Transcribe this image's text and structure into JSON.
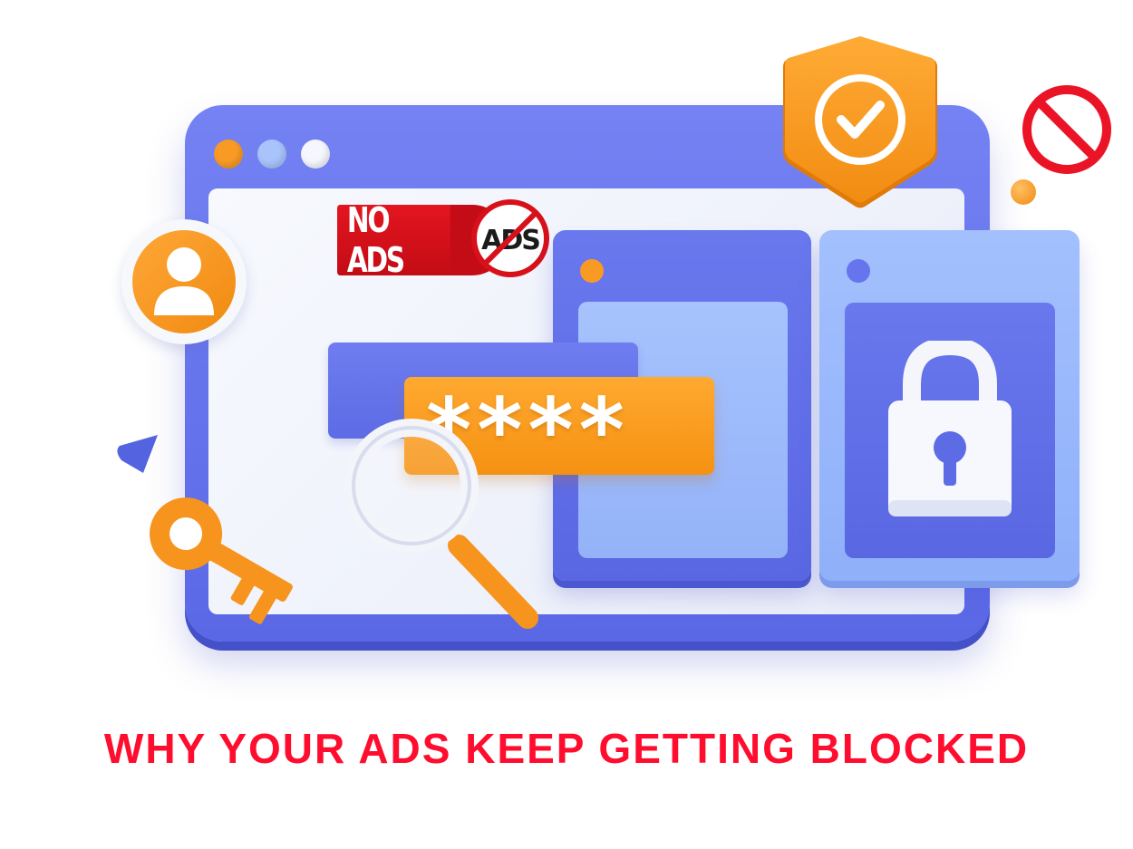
{
  "badge": {
    "no_ads_label": "NO ADS",
    "ads_label": "ADS"
  },
  "password_field": {
    "masked_value": "****"
  },
  "headline": "WHY YOUR ADS KEEP GETTING BLOCKED",
  "colors": {
    "window_blue": "#6674ee",
    "accent_orange": "#f7941d",
    "badge_red": "#d8101a",
    "headline_red": "#ff0d2e",
    "light_blue": "#a3c0fd"
  },
  "icons": [
    "shield-check-icon",
    "prohibited-icon",
    "user-icon",
    "padlock-icon",
    "magnifier-icon",
    "key-icon",
    "cone-icon"
  ]
}
